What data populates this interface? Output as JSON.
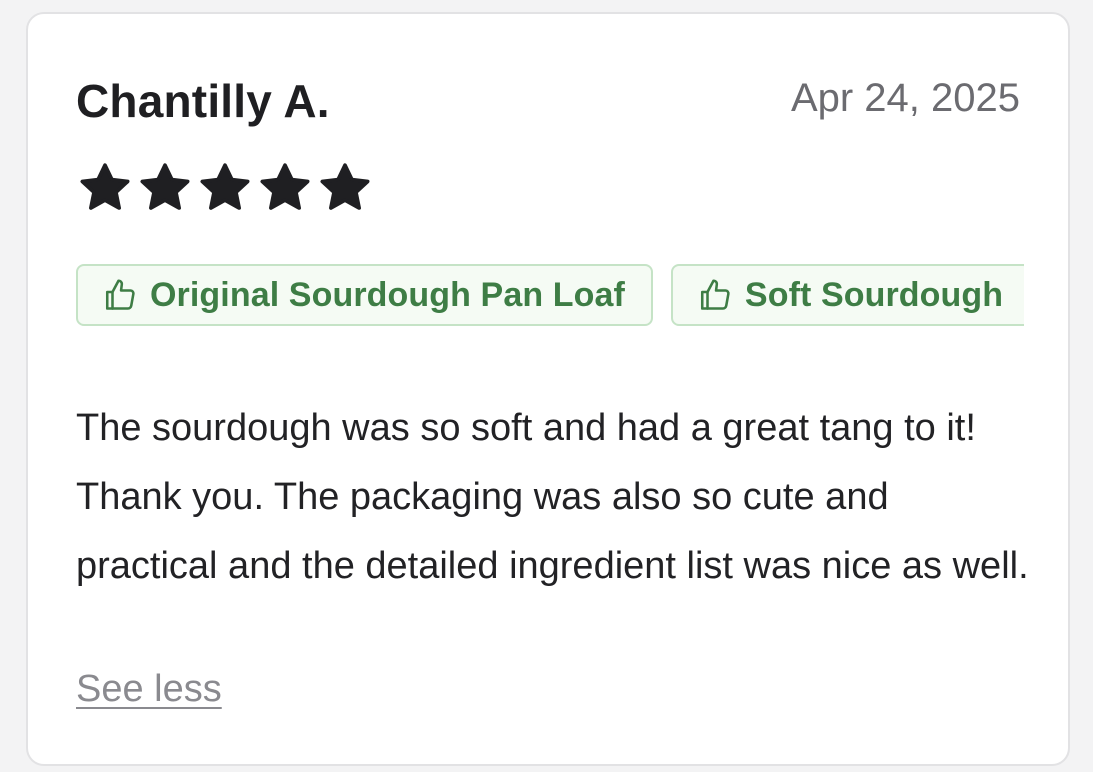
{
  "review": {
    "reviewer_name": "Chantilly A.",
    "date": "Apr 24, 2025",
    "rating": 5,
    "rating_max": 5,
    "tags": [
      {
        "label": "Original Sourdough Pan Loaf",
        "icon": "thumbs-up-icon"
      },
      {
        "label": "Soft Sourdough",
        "icon": "thumbs-up-icon"
      }
    ],
    "body": "The sourdough was so soft and had a great tang to it! Thank you. The packaging was also so cute and practical and the detailed ingredient list was nice as well.",
    "toggle_label": "See less"
  },
  "colors": {
    "star": "#1f1f22",
    "chip_border": "#c5e3c6",
    "chip_background": "#f5fbf4",
    "chip_text": "#3e7d45",
    "link": "#8a8a8f"
  }
}
